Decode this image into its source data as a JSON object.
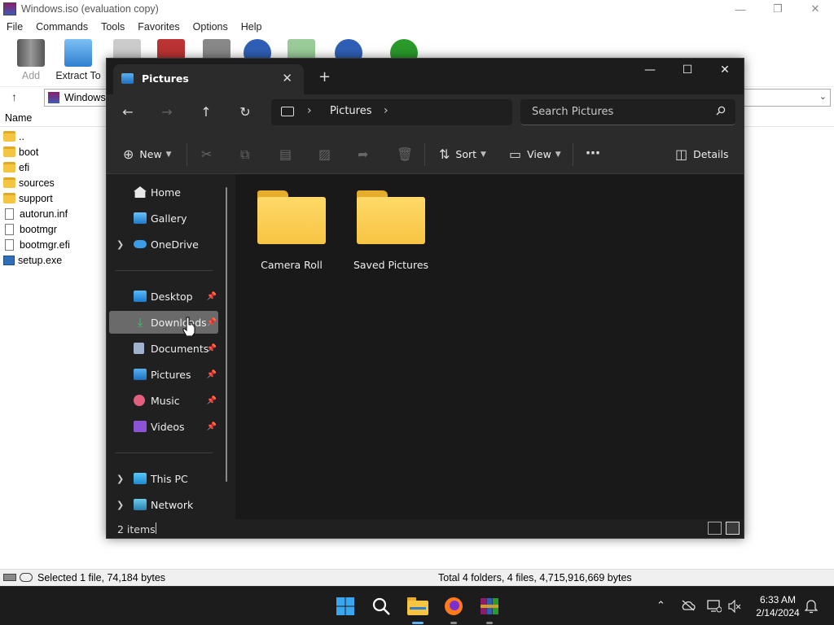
{
  "winrar": {
    "title": "Windows.iso (evaluation copy)",
    "menu": [
      "File",
      "Commands",
      "Tools",
      "Favorites",
      "Options",
      "Help"
    ],
    "toolbar": {
      "add": "Add",
      "extract_to": "Extract To"
    },
    "address": "Windows.",
    "column_header": "Name",
    "files": [
      {
        "name": "..",
        "type": "folder"
      },
      {
        "name": "boot",
        "type": "folder"
      },
      {
        "name": "efi",
        "type": "folder"
      },
      {
        "name": "sources",
        "type": "folder"
      },
      {
        "name": "support",
        "type": "folder"
      },
      {
        "name": "autorun.inf",
        "type": "doc"
      },
      {
        "name": "bootmgr",
        "type": "doc"
      },
      {
        "name": "bootmgr.efi",
        "type": "doc"
      },
      {
        "name": "setup.exe",
        "type": "exe"
      }
    ],
    "status_left": "Selected 1 file, 74,184 bytes",
    "status_right": "Total 4 folders, 4 files, 4,715,916,669 bytes"
  },
  "explorer": {
    "tab_title": "Pictures",
    "breadcrumb": "Pictures",
    "search_placeholder": "Search Pictures",
    "commands": {
      "new": "New",
      "sort": "Sort",
      "view": "View",
      "details": "Details"
    },
    "nav": {
      "home": "Home",
      "gallery": "Gallery",
      "onedrive": "OneDrive",
      "desktop": "Desktop",
      "downloads": "Downloads",
      "documents": "Documents",
      "pictures": "Pictures",
      "music": "Music",
      "videos": "Videos",
      "this_pc": "This PC",
      "network": "Network"
    },
    "folders": [
      "Camera Roll",
      "Saved Pictures"
    ],
    "status_count": "2 items"
  },
  "taskbar": {
    "time": "6:33 AM",
    "date": "2/14/2024"
  },
  "colors": {
    "explorer_bg": "#202020",
    "selection": "#6a6a6a",
    "folder_yellow": "#f7c443",
    "accent": "#5fb2f2"
  }
}
